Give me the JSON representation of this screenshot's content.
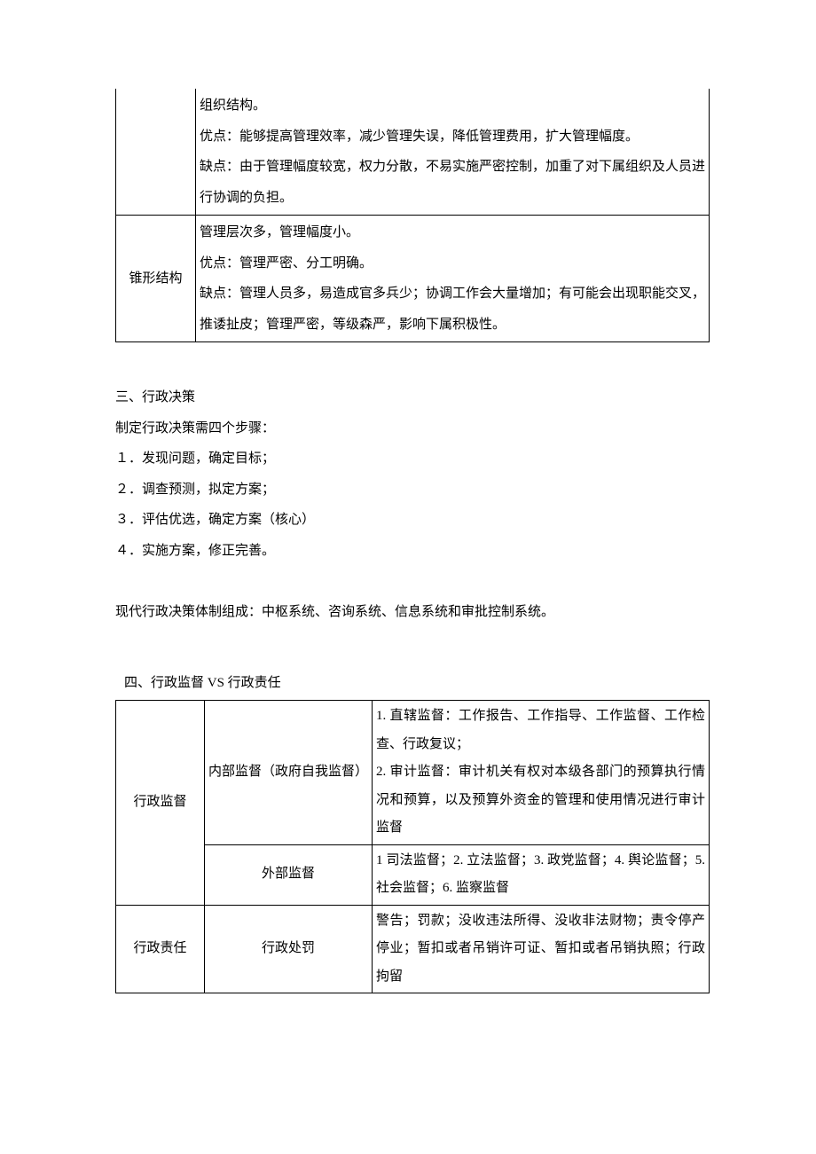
{
  "table1": {
    "row1": {
      "col1": "",
      "col2": "组织结构。\n优点：能够提高管理效率，减少管理失误，降低管理费用，扩大管理幅度。\n缺点：由于管理幅度较宽，权力分散，不易实施严密控制，加重了对下属组织及人员进行协调的负担。"
    },
    "row2": {
      "col1": "锥形结构",
      "col2": "管理层次多，管理幅度小。\n优点：管理严密、分工明确。\n缺点：管理人员多，易造成官多兵少；协调工作会大量增加；有可能会出现职能交叉，推诿扯皮；管理严密，等级森严，影响下属积极性。"
    }
  },
  "section3": {
    "title": "三、行政决策",
    "intro": "制定行政决策需四个步骤：",
    "step1": "１．发现问题，确定目标；",
    "step2": "２．调查预测，拟定方案；",
    "step3": "３．评估优选，确定方案（核心）",
    "step4": "４．实施方案，修正完善。",
    "composition": "现代行政决策体制组成：中枢系统、咨询系统、信息系统和审批控制系统。"
  },
  "section4": {
    "title": "四、行政监督 VS 行政责任"
  },
  "table2": {
    "row1": {
      "col1": "行政监督",
      "col2": "内部监督（政府自我监督）",
      "col3": "1. 直辖监督：工作报告、工作指导、工作监督、工作检查、行政复议；\n2. 审计监督：审计机关有权对本级各部门的预算执行情况和预算，以及预算外资金的管理和使用情况进行审计监督"
    },
    "row2": {
      "col2": "外部监督",
      "col3": "1 司法监督；2. 立法监督；3. 政党监督；4. 舆论监督；5. 社会监督；6. 监察监督"
    },
    "row3": {
      "col1": "行政责任",
      "col2": "行政处罚",
      "col3": "警告；罚款；没收违法所得、没收非法财物；责令停产停业；暂扣或者吊销许可证、暂扣或者吊销执照；行政拘留"
    }
  }
}
